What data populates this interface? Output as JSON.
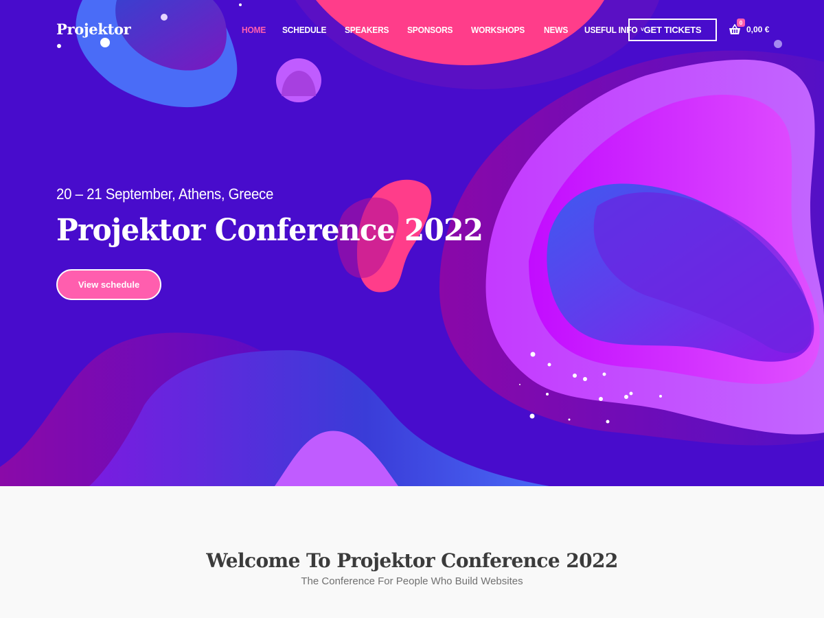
{
  "header": {
    "logo": "Projektor",
    "nav": [
      {
        "label": "HOME",
        "active": true
      },
      {
        "label": "SCHEDULE",
        "active": false
      },
      {
        "label": "SPEAKERS",
        "active": false
      },
      {
        "label": "SPONSORS",
        "active": false
      },
      {
        "label": "WORKSHOPS",
        "active": false
      },
      {
        "label": "NEWS",
        "active": false
      },
      {
        "label": "USEFUL INFO",
        "active": false,
        "dropdown": true
      }
    ],
    "dropdown_glyph": "˅",
    "tickets_label": "GET TICKETS",
    "cart": {
      "icon": "basket-icon",
      "count": "0",
      "total": "0,00 €"
    }
  },
  "hero": {
    "date": "20 – 21 September, Athens, Greece",
    "title": "Projektor Conference 2022",
    "button_label": "View schedule"
  },
  "welcome": {
    "title": "Welcome To Projektor Conference 2022",
    "subtitle": "The Conference For People Who Build Websites"
  },
  "colors": {
    "background": "#480ccc",
    "accent_pink": "#ff5eae",
    "hot_pink": "#ff3d8a",
    "blue": "#4a6cf7",
    "violet": "#c05cff",
    "magenta": "#d835ff"
  }
}
